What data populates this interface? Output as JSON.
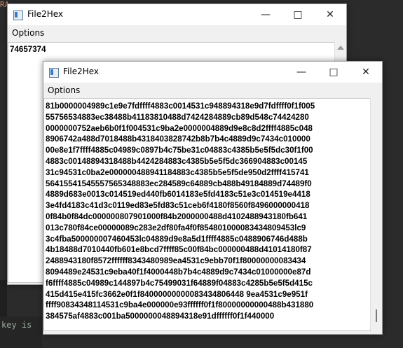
{
  "background": {
    "editor_fragment_top": "RA",
    "editor_fragment_bottom": "key is"
  },
  "window_back": {
    "title": "File2Hex",
    "menu": "Options",
    "content": "74657374"
  },
  "window_front": {
    "title": "File2Hex",
    "menu": "Options",
    "lines": [
      "81b0000004989c1e9e7fdffff4883c0014531c948894318e9d7fdffff0f1f005",
      "55756534883ec38488b41183810488d7424284889cb89d548c74424280",
      "0000000752aeb6b0f1f004531c9ba2e0000004889d9e8c8d2ffff4885c048",
      "8906742a488d7018488b4318403828742b8b7b4c4889d9c7434c010000",
      "00e8e1f7ffff4885c04989c0897b4c75be31c04883c4385b5e5f5dc30f1f00",
      "4883c00148894318488b4424284883c4385b5e5f5dc366904883c00145",
      "31c94531c0ba2e000000488941184883c4385b5e5f5de950d2ffff415741",
      "56415541545557565348883ec284589c64889cb488b49184889d74489f0",
      "4889d683e0013c014519ed440fb6014183e5fd4183c51e3c014519e4418",
      "3e4fd4183c41d3c0119ed83e5fd83c51ceb6f4180f8560f8496000000418",
      "0f84b0f84dc000000807901000f84b2000000488d4102488943180fb641",
      "013c780f84ce00000089c283e2df80fa4f0f854801000083434809453lc9",
      "3c4fba500000007460453lc04889d9e8a5d1ffff4885c0488906746d488b",
      "4b18488d7010440fb601e8bcd7ffff85c00f84bc000000488d41014180f87",
      "2488943180f8572ffffff8343480989ea4531c9ebb70f1f80000000083434",
      "8094489e24531c9eba40f1f4000448b7b4c4889d9c7434c01000000e87d",
      "f6ffff4885c04989c144897b4c75499031f64889f04883c4285b5e5f5d415c",
      "415d415e415fc3662e0f1f84000000000083434806448 9ea4531c9e951f",
      "ffff90834348114531c9ba4e000000e93ffffff0f1f80000000000488b431880",
      "384575af4883c001ba5000000048894318e91dffffff0f1f440000"
    ]
  }
}
